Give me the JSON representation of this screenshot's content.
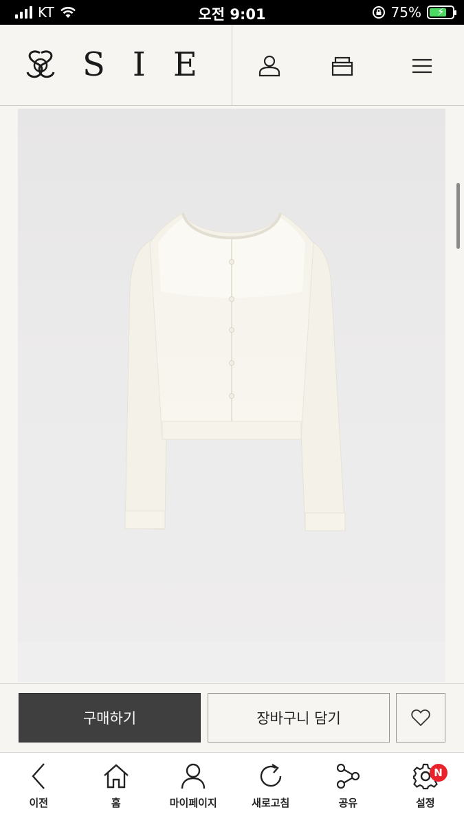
{
  "status_bar": {
    "carrier": "KT",
    "time": "오전 9:01",
    "battery_percent": "75%",
    "battery_level": 0.75
  },
  "header": {
    "brand": "SIE",
    "icons": [
      "user-icon",
      "cart-icon",
      "menu-icon"
    ]
  },
  "product": {
    "image_alt_icon": "cardigan-image",
    "colors": {
      "background": "#e9e8e8",
      "garment": "#f7f4ec"
    }
  },
  "actions": {
    "buy_label": "구매하기",
    "cart_label": "장바구니 담기",
    "wish_icon": "heart-icon"
  },
  "bottom_nav": {
    "items": [
      {
        "label": "이전",
        "icon": "back-arrow-icon"
      },
      {
        "label": "홈",
        "icon": "home-icon"
      },
      {
        "label": "마이페이지",
        "icon": "profile-icon"
      },
      {
        "label": "새로고침",
        "icon": "refresh-icon"
      },
      {
        "label": "공유",
        "icon": "share-icon"
      },
      {
        "label": "설정",
        "icon": "settings-icon",
        "badge": "N"
      }
    ]
  },
  "colors": {
    "accent_dark": "#3f3f3f",
    "badge_red": "#e8232b",
    "page_bg": "#f6f5f1"
  }
}
